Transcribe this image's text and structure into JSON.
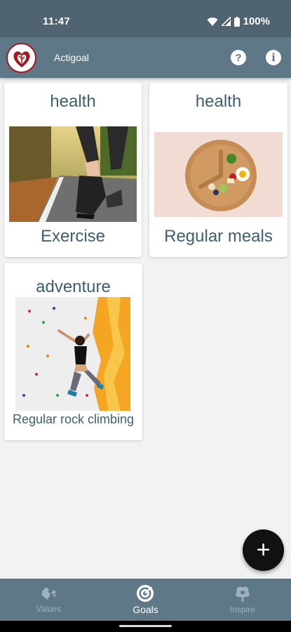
{
  "status_bar": {
    "time": "11:47",
    "battery": "100%"
  },
  "app_bar": {
    "title": "Actigoal",
    "help_label": "?",
    "info_label": "i"
  },
  "goals": [
    {
      "category": "health",
      "name": "Exercise",
      "image": "running-shoes-on-road"
    },
    {
      "category": "health",
      "name": "Regular meals",
      "image": "plate-clock-with-vegetables"
    },
    {
      "category": "adventure",
      "name": "Regular rock climbing",
      "image": "climber-on-wall"
    }
  ],
  "fab": {
    "label": "+"
  },
  "bottom_nav": {
    "items": [
      {
        "label": "Values",
        "icon": "puzzle-heart-icon",
        "active": false
      },
      {
        "label": "Goals",
        "icon": "target-icon",
        "active": true
      },
      {
        "label": "Inspire",
        "icon": "tree-heart-icon",
        "active": false
      }
    ]
  },
  "colors": {
    "primary": "#5f7887",
    "status": "#4f6470",
    "text": "#3d5f73",
    "fab": "#111111"
  }
}
